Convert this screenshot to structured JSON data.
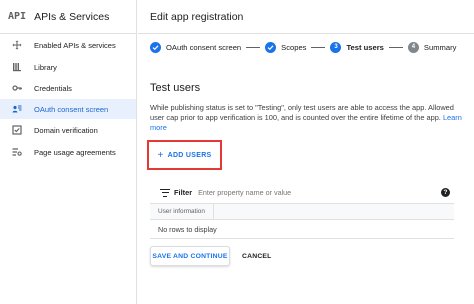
{
  "sidebar": {
    "logo": "API",
    "title": "APIs & Services",
    "items": [
      {
        "label": "Enabled APIs & services",
        "icon": "diamond-move-icon",
        "active": false
      },
      {
        "label": "Library",
        "icon": "library-icon",
        "active": false
      },
      {
        "label": "Credentials",
        "icon": "key-icon",
        "active": false
      },
      {
        "label": "OAuth consent screen",
        "icon": "consent-icon",
        "active": true
      },
      {
        "label": "Domain verification",
        "icon": "checkbox-icon",
        "active": false
      },
      {
        "label": "Page usage agreements",
        "icon": "settings-list-icon",
        "active": false
      }
    ]
  },
  "main": {
    "title": "Edit app registration",
    "steps": [
      {
        "label": "OAuth consent screen",
        "state": "done",
        "number": ""
      },
      {
        "label": "Scopes",
        "state": "done",
        "number": ""
      },
      {
        "label": "Test users",
        "state": "current",
        "number": "3"
      },
      {
        "label": "Summary",
        "state": "todo",
        "number": "4"
      }
    ],
    "section_title": "Test users",
    "description": "While publishing status is set to \"Testing\", only test users are able to access the app. Allowed user cap prior to app verification is 100, and is counted over the entire lifetime of the app.",
    "learn_more": "Learn more",
    "add_users_label": "ADD USERS",
    "filter_label": "Filter",
    "filter_placeholder": "Enter property name or value",
    "column_header": "User information",
    "empty_text": "No rows to display",
    "save_label": "SAVE AND CONTINUE",
    "cancel_label": "CANCEL"
  },
  "colors": {
    "accent": "#1a73e8",
    "highlight_border": "#e53935",
    "active_bg": "#e8f0fe"
  }
}
